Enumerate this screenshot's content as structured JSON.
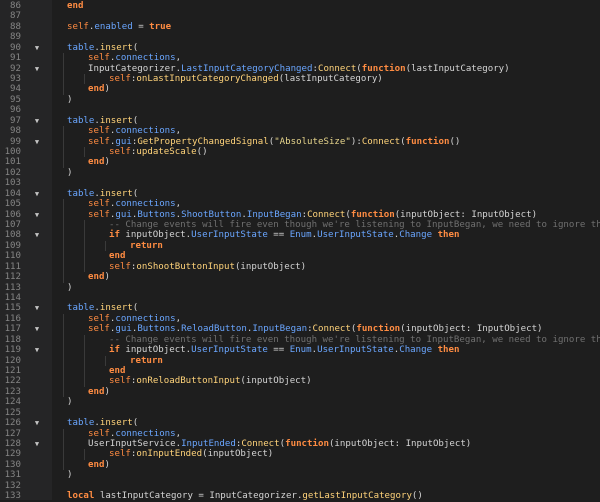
{
  "editor": {
    "lines": [
      {
        "n": "86",
        "fold": false,
        "indent": 1,
        "tokens": [
          [
            "k",
            "end"
          ]
        ]
      },
      {
        "n": "87",
        "fold": false,
        "indent": 0,
        "tokens": []
      },
      {
        "n": "88",
        "fold": false,
        "indent": 1,
        "tokens": [
          [
            "s",
            "self"
          ],
          [
            "p",
            "."
          ],
          [
            "m",
            "enabled"
          ],
          [
            "p",
            " = "
          ],
          [
            "b",
            "true"
          ]
        ]
      },
      {
        "n": "89",
        "fold": false,
        "indent": 0,
        "tokens": []
      },
      {
        "n": "90",
        "fold": true,
        "indent": 1,
        "tokens": [
          [
            "m",
            "table"
          ],
          [
            "p",
            "."
          ],
          [
            "f",
            "insert"
          ],
          [
            "p",
            "("
          ]
        ]
      },
      {
        "n": "91",
        "fold": false,
        "indent": 2,
        "tokens": [
          [
            "s",
            "self"
          ],
          [
            "p",
            "."
          ],
          [
            "m",
            "connections"
          ],
          [
            "p",
            ","
          ]
        ]
      },
      {
        "n": "92",
        "fold": true,
        "indent": 2,
        "tokens": [
          [
            "p",
            "InputCategorizer."
          ],
          [
            "m",
            "LastInputCategoryChanged"
          ],
          [
            "p",
            ":"
          ],
          [
            "f",
            "Connect"
          ],
          [
            "p",
            "("
          ],
          [
            "k",
            "function"
          ],
          [
            "p",
            "(lastInputCategory)"
          ]
        ]
      },
      {
        "n": "93",
        "fold": false,
        "indent": 3,
        "tokens": [
          [
            "s",
            "self"
          ],
          [
            "p",
            ":"
          ],
          [
            "f",
            "onLastInputCategoryChanged"
          ],
          [
            "p",
            "(lastInputCategory)"
          ]
        ]
      },
      {
        "n": "94",
        "fold": false,
        "indent": 2,
        "tokens": [
          [
            "k",
            "end"
          ],
          [
            "p",
            ")"
          ]
        ]
      },
      {
        "n": "95",
        "fold": false,
        "indent": 1,
        "tokens": [
          [
            "p",
            ")"
          ]
        ]
      },
      {
        "n": "96",
        "fold": false,
        "indent": 0,
        "tokens": []
      },
      {
        "n": "97",
        "fold": true,
        "indent": 1,
        "tokens": [
          [
            "m",
            "table"
          ],
          [
            "p",
            "."
          ],
          [
            "f",
            "insert"
          ],
          [
            "p",
            "("
          ]
        ]
      },
      {
        "n": "98",
        "fold": false,
        "indent": 2,
        "tokens": [
          [
            "s",
            "self"
          ],
          [
            "p",
            "."
          ],
          [
            "m",
            "connections"
          ],
          [
            "p",
            ","
          ]
        ]
      },
      {
        "n": "99",
        "fold": true,
        "indent": 2,
        "tokens": [
          [
            "s",
            "self"
          ],
          [
            "p",
            "."
          ],
          [
            "m",
            "gui"
          ],
          [
            "p",
            ":"
          ],
          [
            "f",
            "GetPropertyChangedSignal"
          ],
          [
            "p",
            "("
          ],
          [
            "t",
            "\"AbsoluteSize\""
          ],
          [
            "p",
            ")"
          ],
          [
            "p",
            ":"
          ],
          [
            "f",
            "Connect"
          ],
          [
            "p",
            "("
          ],
          [
            "k",
            "function"
          ],
          [
            "p",
            "()"
          ]
        ]
      },
      {
        "n": "100",
        "fold": false,
        "indent": 3,
        "tokens": [
          [
            "s",
            "self"
          ],
          [
            "p",
            ":"
          ],
          [
            "f",
            "updateScale"
          ],
          [
            "p",
            "()"
          ]
        ]
      },
      {
        "n": "101",
        "fold": false,
        "indent": 2,
        "tokens": [
          [
            "k",
            "end"
          ],
          [
            "p",
            ")"
          ]
        ]
      },
      {
        "n": "102",
        "fold": false,
        "indent": 1,
        "tokens": [
          [
            "p",
            ")"
          ]
        ]
      },
      {
        "n": "103",
        "fold": false,
        "indent": 0,
        "tokens": []
      },
      {
        "n": "104",
        "fold": true,
        "indent": 1,
        "tokens": [
          [
            "m",
            "table"
          ],
          [
            "p",
            "."
          ],
          [
            "f",
            "insert"
          ],
          [
            "p",
            "("
          ]
        ]
      },
      {
        "n": "105",
        "fold": false,
        "indent": 2,
        "tokens": [
          [
            "s",
            "self"
          ],
          [
            "p",
            "."
          ],
          [
            "m",
            "connections"
          ],
          [
            "p",
            ","
          ]
        ]
      },
      {
        "n": "106",
        "fold": true,
        "indent": 2,
        "tokens": [
          [
            "s",
            "self"
          ],
          [
            "p",
            "."
          ],
          [
            "m",
            "gui"
          ],
          [
            "p",
            "."
          ],
          [
            "m",
            "Buttons"
          ],
          [
            "p",
            "."
          ],
          [
            "m",
            "ShootButton"
          ],
          [
            "p",
            "."
          ],
          [
            "m",
            "InputBegan"
          ],
          [
            "p",
            ":"
          ],
          [
            "f",
            "Connect"
          ],
          [
            "p",
            "("
          ],
          [
            "k",
            "function"
          ],
          [
            "p",
            "(inputObject: InputObject)"
          ]
        ]
      },
      {
        "n": "107",
        "fold": false,
        "indent": 3,
        "tokens": [
          [
            "c",
            "-- Change events will fire even though we're listening to InputBegan, we need to ignore those"
          ]
        ]
      },
      {
        "n": "108",
        "fold": true,
        "indent": 3,
        "tokens": [
          [
            "k",
            "if"
          ],
          [
            "p",
            " inputObject."
          ],
          [
            "m",
            "UserInputState"
          ],
          [
            "p",
            " == "
          ],
          [
            "m",
            "Enum"
          ],
          [
            "p",
            "."
          ],
          [
            "m",
            "UserInputState"
          ],
          [
            "p",
            "."
          ],
          [
            "m",
            "Change"
          ],
          [
            "p",
            " "
          ],
          [
            "k",
            "then"
          ]
        ]
      },
      {
        "n": "109",
        "fold": false,
        "indent": 4,
        "tokens": [
          [
            "k",
            "return"
          ]
        ]
      },
      {
        "n": "110",
        "fold": false,
        "indent": 3,
        "tokens": [
          [
            "k",
            "end"
          ]
        ]
      },
      {
        "n": "111",
        "fold": false,
        "indent": 3,
        "tokens": [
          [
            "s",
            "self"
          ],
          [
            "p",
            ":"
          ],
          [
            "f",
            "onShootButtonInput"
          ],
          [
            "p",
            "(inputObject)"
          ]
        ]
      },
      {
        "n": "112",
        "fold": false,
        "indent": 2,
        "tokens": [
          [
            "k",
            "end"
          ],
          [
            "p",
            ")"
          ]
        ]
      },
      {
        "n": "113",
        "fold": false,
        "indent": 1,
        "tokens": [
          [
            "p",
            ")"
          ]
        ]
      },
      {
        "n": "114",
        "fold": false,
        "indent": 0,
        "tokens": []
      },
      {
        "n": "115",
        "fold": true,
        "indent": 1,
        "tokens": [
          [
            "m",
            "table"
          ],
          [
            "p",
            "."
          ],
          [
            "f",
            "insert"
          ],
          [
            "p",
            "("
          ]
        ]
      },
      {
        "n": "116",
        "fold": false,
        "indent": 2,
        "tokens": [
          [
            "s",
            "self"
          ],
          [
            "p",
            "."
          ],
          [
            "m",
            "connections"
          ],
          [
            "p",
            ","
          ]
        ]
      },
      {
        "n": "117",
        "fold": true,
        "indent": 2,
        "tokens": [
          [
            "s",
            "self"
          ],
          [
            "p",
            "."
          ],
          [
            "m",
            "gui"
          ],
          [
            "p",
            "."
          ],
          [
            "m",
            "Buttons"
          ],
          [
            "p",
            "."
          ],
          [
            "m",
            "ReloadButton"
          ],
          [
            "p",
            "."
          ],
          [
            "m",
            "InputBegan"
          ],
          [
            "p",
            ":"
          ],
          [
            "f",
            "Connect"
          ],
          [
            "p",
            "("
          ],
          [
            "k",
            "function"
          ],
          [
            "p",
            "(inputObject: InputObject)"
          ]
        ]
      },
      {
        "n": "118",
        "fold": false,
        "indent": 3,
        "tokens": [
          [
            "c",
            "-- Change events will fire even though we're listening to InputBegan, we need to ignore those"
          ]
        ]
      },
      {
        "n": "119",
        "fold": true,
        "indent": 3,
        "tokens": [
          [
            "k",
            "if"
          ],
          [
            "p",
            " inputObject."
          ],
          [
            "m",
            "UserInputState"
          ],
          [
            "p",
            " == "
          ],
          [
            "m",
            "Enum"
          ],
          [
            "p",
            "."
          ],
          [
            "m",
            "UserInputState"
          ],
          [
            "p",
            "."
          ],
          [
            "m",
            "Change"
          ],
          [
            "p",
            " "
          ],
          [
            "k",
            "then"
          ]
        ]
      },
      {
        "n": "120",
        "fold": false,
        "indent": 4,
        "tokens": [
          [
            "k",
            "return"
          ]
        ]
      },
      {
        "n": "121",
        "fold": false,
        "indent": 3,
        "tokens": [
          [
            "k",
            "end"
          ]
        ]
      },
      {
        "n": "122",
        "fold": false,
        "indent": 3,
        "tokens": [
          [
            "s",
            "self"
          ],
          [
            "p",
            ":"
          ],
          [
            "f",
            "onReloadButtonInput"
          ],
          [
            "p",
            "(inputObject)"
          ]
        ]
      },
      {
        "n": "123",
        "fold": false,
        "indent": 2,
        "tokens": [
          [
            "k",
            "end"
          ],
          [
            "p",
            ")"
          ]
        ]
      },
      {
        "n": "124",
        "fold": false,
        "indent": 1,
        "tokens": [
          [
            "p",
            ")"
          ]
        ]
      },
      {
        "n": "125",
        "fold": false,
        "indent": 0,
        "tokens": []
      },
      {
        "n": "126",
        "fold": true,
        "indent": 1,
        "tokens": [
          [
            "m",
            "table"
          ],
          [
            "p",
            "."
          ],
          [
            "f",
            "insert"
          ],
          [
            "p",
            "("
          ]
        ]
      },
      {
        "n": "127",
        "fold": false,
        "indent": 2,
        "tokens": [
          [
            "s",
            "self"
          ],
          [
            "p",
            "."
          ],
          [
            "m",
            "connections"
          ],
          [
            "p",
            ","
          ]
        ]
      },
      {
        "n": "128",
        "fold": true,
        "indent": 2,
        "tokens": [
          [
            "p",
            "UserInputService."
          ],
          [
            "m",
            "InputEnded"
          ],
          [
            "p",
            ":"
          ],
          [
            "f",
            "Connect"
          ],
          [
            "p",
            "("
          ],
          [
            "k",
            "function"
          ],
          [
            "p",
            "(inputObject: InputObject)"
          ]
        ]
      },
      {
        "n": "129",
        "fold": false,
        "indent": 3,
        "tokens": [
          [
            "s",
            "self"
          ],
          [
            "p",
            ":"
          ],
          [
            "f",
            "onInputEnded"
          ],
          [
            "p",
            "(inputObject)"
          ]
        ]
      },
      {
        "n": "130",
        "fold": false,
        "indent": 2,
        "tokens": [
          [
            "k",
            "end"
          ],
          [
            "p",
            ")"
          ]
        ]
      },
      {
        "n": "131",
        "fold": false,
        "indent": 1,
        "tokens": [
          [
            "p",
            ")"
          ]
        ]
      },
      {
        "n": "132",
        "fold": false,
        "indent": 0,
        "tokens": []
      },
      {
        "n": "133",
        "fold": false,
        "indent": 1,
        "tokens": [
          [
            "k",
            "local"
          ],
          [
            "p",
            " lastInputCategory = InputCategorizer."
          ],
          [
            "f",
            "getLastInputCategory"
          ],
          [
            "p",
            "()"
          ]
        ]
      }
    ]
  }
}
